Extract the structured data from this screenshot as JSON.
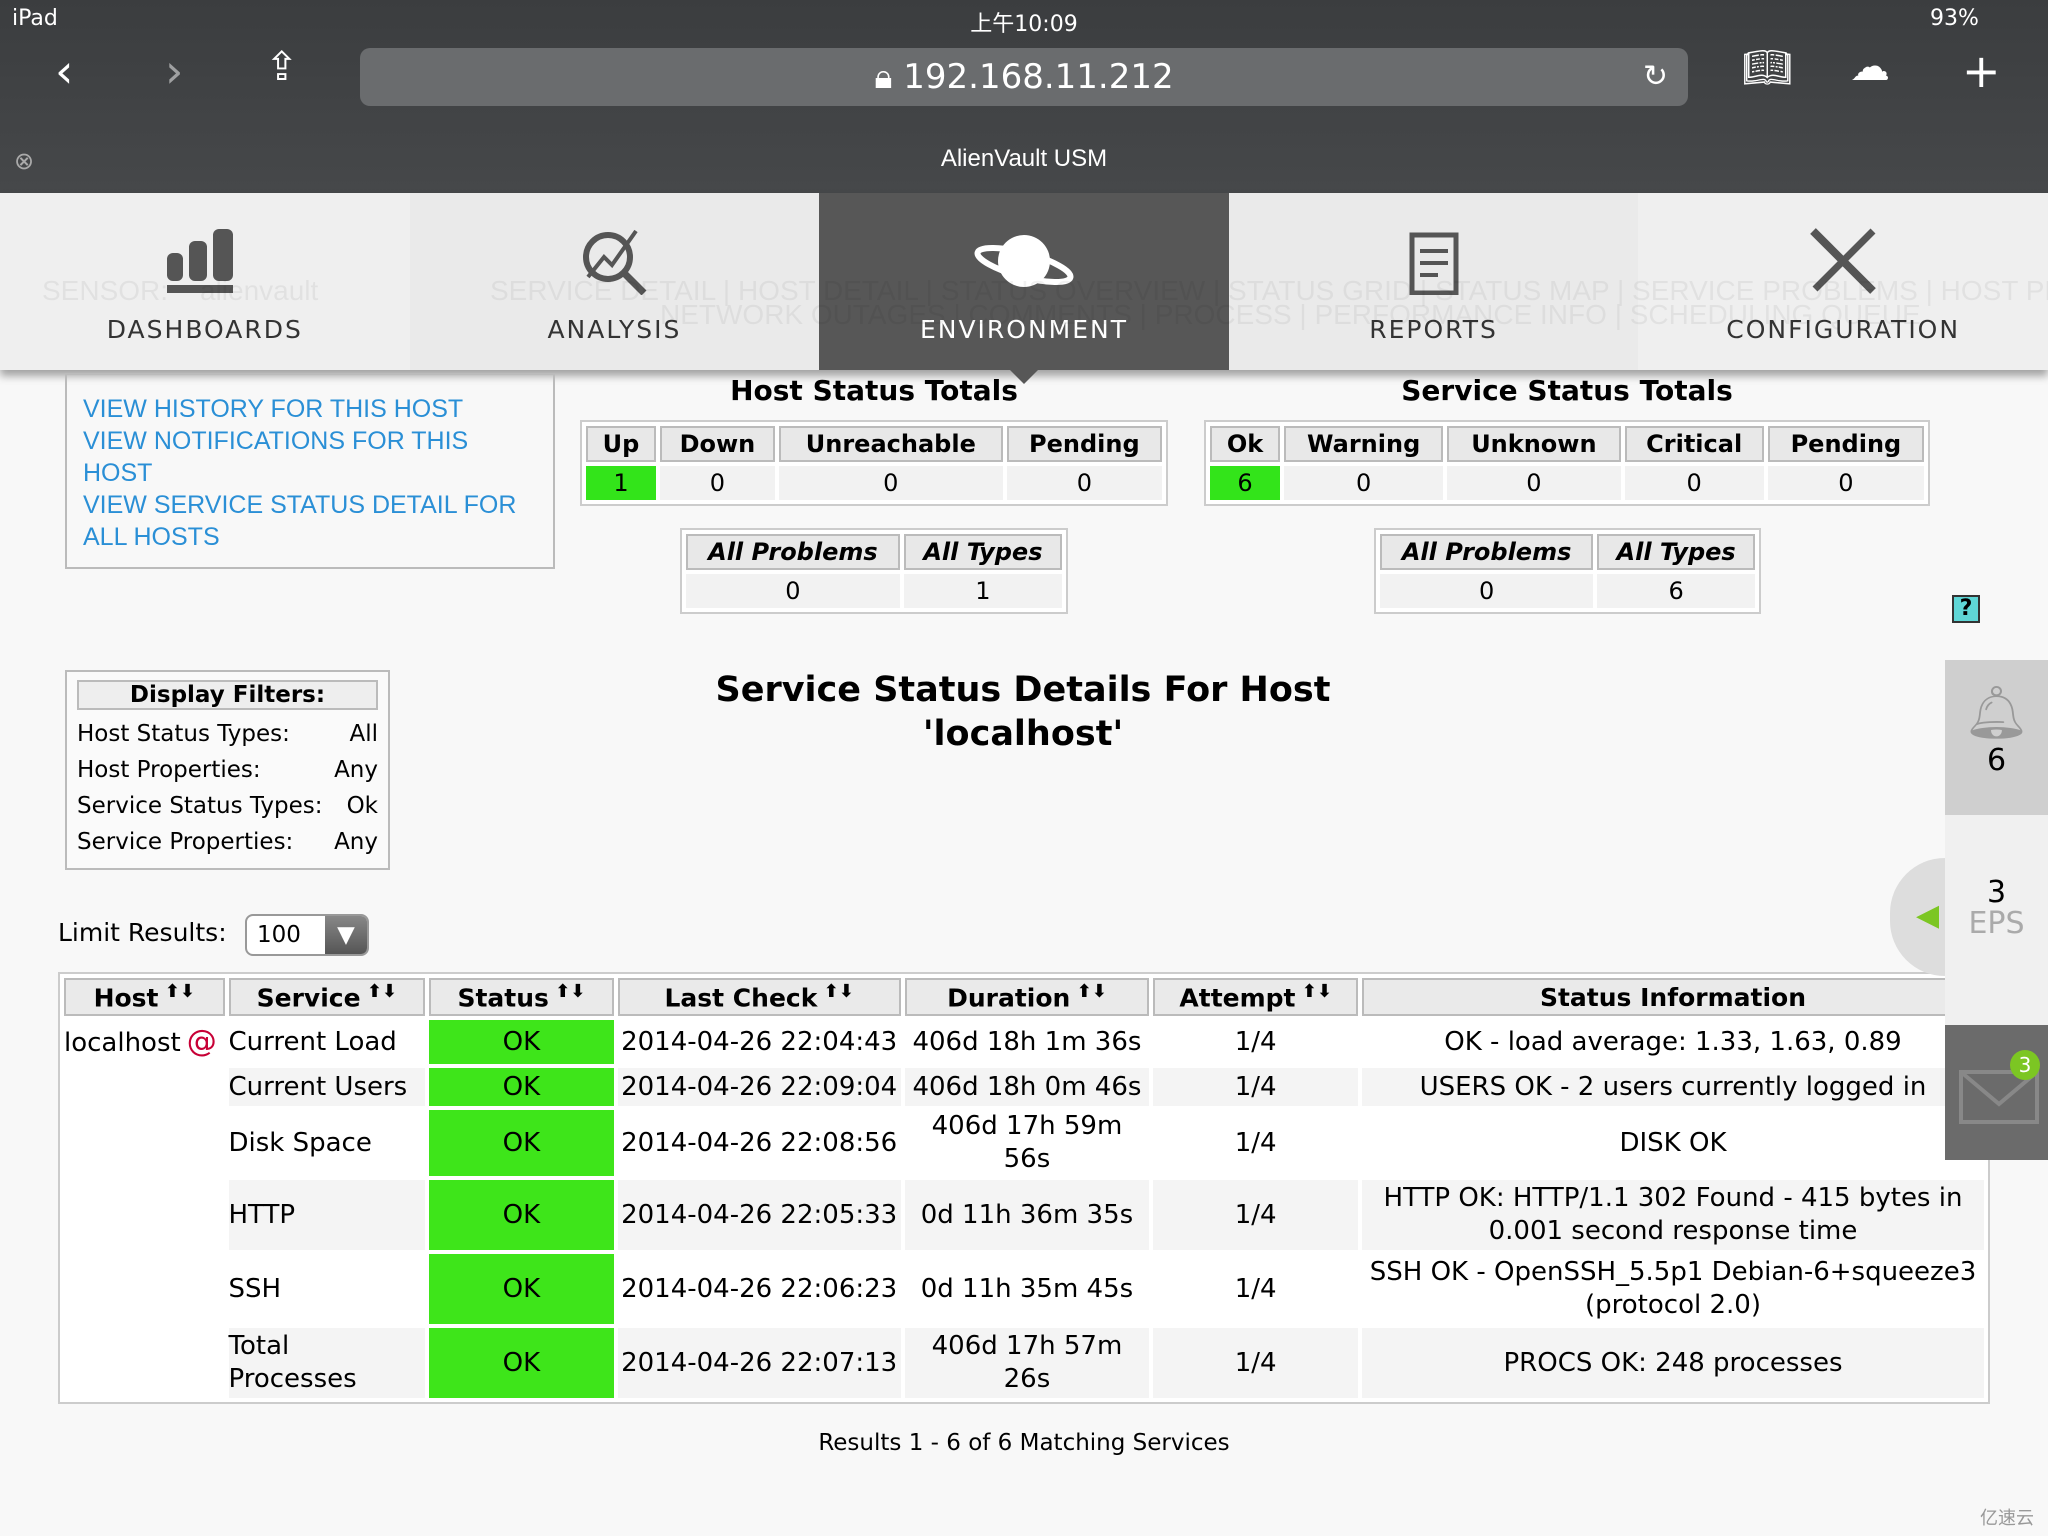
{
  "status_bar": {
    "device": "iPad",
    "time": "上午10:09",
    "battery": "93%"
  },
  "browser": {
    "url": "192.168.11.212",
    "page_title": "AlienVault USM"
  },
  "nav": {
    "tabs": [
      {
        "label": "DASHBOARDS"
      },
      {
        "label": "ANALYSIS"
      },
      {
        "label": "ENVIRONMENT",
        "active": true
      },
      {
        "label": "REPORTS"
      },
      {
        "label": "CONFIGURATION"
      }
    ]
  },
  "background_text": {
    "sensor": "SENSOR:",
    "sensor_value": "alienvault",
    "menu_line1": "SERVICE DETAIL | HOST DETAIL | STATUS OVERVIEW | STATUS GRID | STATUS MAP | SERVICE PROBLEMS | HOST PROBLEMS",
    "menu_line2": "NETWORK OUTAGES | COMMENTS | PROCESS | PERFORMANCE INFO | SCHEDULING QUEUE"
  },
  "links": [
    "VIEW HISTORY FOR THIS HOST",
    "VIEW NOTIFICATIONS FOR THIS HOST",
    "VIEW SERVICE STATUS DETAIL FOR ALL HOSTS"
  ],
  "host_totals": {
    "title": "Host Status Totals",
    "headers": [
      "Up",
      "Down",
      "Unreachable",
      "Pending"
    ],
    "values": [
      "1",
      "0",
      "0",
      "0"
    ],
    "problems_headers": [
      "All Problems",
      "All Types"
    ],
    "problems_values": [
      "0",
      "1"
    ]
  },
  "service_totals": {
    "title": "Service Status Totals",
    "headers": [
      "Ok",
      "Warning",
      "Unknown",
      "Critical",
      "Pending"
    ],
    "values": [
      "6",
      "0",
      "0",
      "0",
      "0"
    ],
    "problems_headers": [
      "All Problems",
      "All Types"
    ],
    "problems_values": [
      "0",
      "6"
    ]
  },
  "help": "?",
  "filters": {
    "title": "Display Filters:",
    "rows": [
      [
        "Host Status Types:",
        "All"
      ],
      [
        "Host Properties:",
        "Any"
      ],
      [
        "Service Status Types:",
        "Ok"
      ],
      [
        "Service Properties:",
        "Any"
      ]
    ]
  },
  "title": {
    "line1": "Service Status Details For Host",
    "line2": "'localhost'"
  },
  "limit": {
    "label": "Limit Results:",
    "value": "100"
  },
  "table": {
    "headers": [
      "Host",
      "Service",
      "Status",
      "Last Check",
      "Duration",
      "Attempt",
      "Status Information"
    ],
    "rows": [
      [
        "localhost",
        "Current Load",
        "OK",
        "2014-04-26 22:04:43",
        "406d 18h 1m 36s",
        "1/4",
        "OK - load average: 1.33, 1.63, 0.89"
      ],
      [
        "",
        "Current Users",
        "OK",
        "2014-04-26 22:09:04",
        "406d 18h 0m 46s",
        "1/4",
        "USERS OK - 2 users currently logged in"
      ],
      [
        "",
        "Disk Space",
        "OK",
        "2014-04-26 22:08:56",
        "406d 17h 59m 56s",
        "1/4",
        "DISK OK"
      ],
      [
        "",
        "HTTP",
        "OK",
        "2014-04-26 22:05:33",
        "0d 11h 36m 35s",
        "1/4",
        "HTTP OK: HTTP/1.1 302 Found - 415 bytes in 0.001 second response time"
      ],
      [
        "",
        "SSH",
        "OK",
        "2014-04-26 22:06:23",
        "0d 11h 35m 45s",
        "1/4",
        "SSH OK - OpenSSH_5.5p1 Debian-6+squeeze3 (protocol 2.0)"
      ],
      [
        "",
        "Total Processes",
        "OK",
        "2014-04-26 22:07:13",
        "406d 17h 57m 26s",
        "1/4",
        "PROCS OK: 248 processes"
      ]
    ]
  },
  "results": "Results 1 - 6 of 6 Matching Services",
  "sidebar": {
    "alarms": "6",
    "eps_value": "3",
    "eps_label": "EPS",
    "messages": "3"
  },
  "colors": {
    "ok": "#3ee51a",
    "link": "#2a8fd6",
    "nav_active": "#575757"
  },
  "watermark": "亿速云"
}
